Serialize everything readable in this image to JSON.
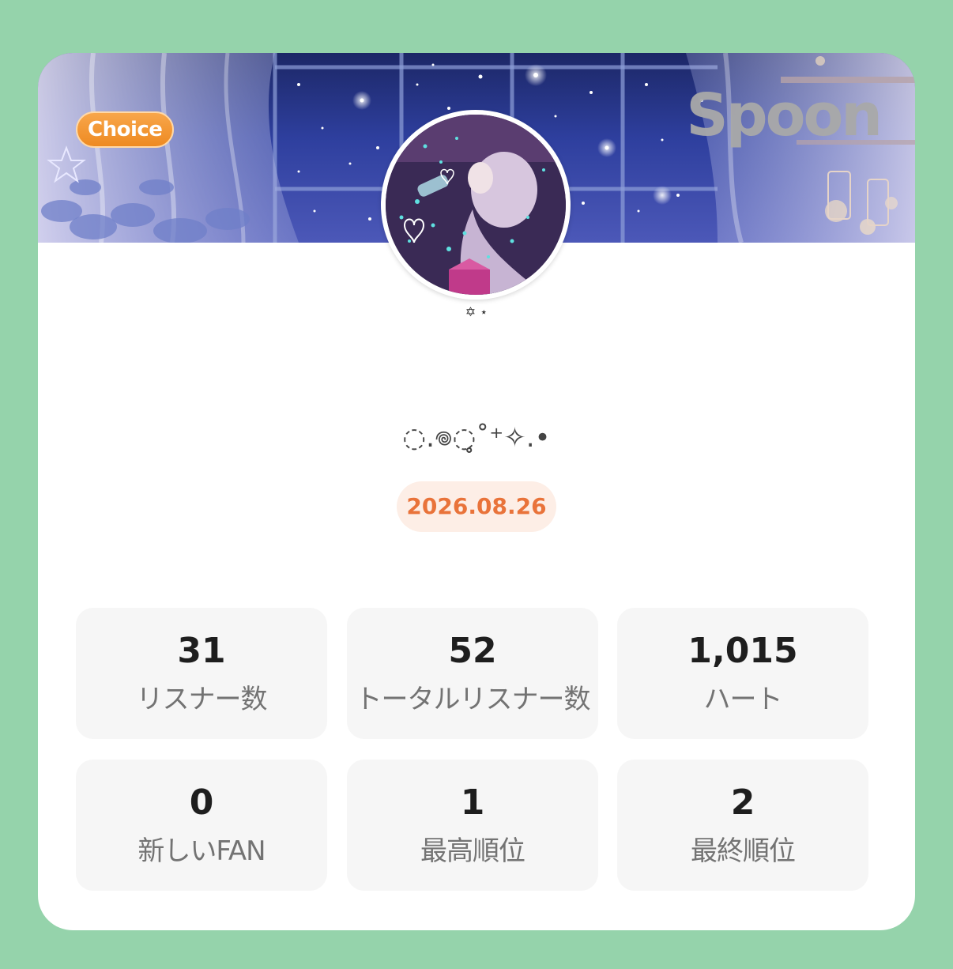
{
  "card": {
    "badge": "Choice",
    "brand": "Spoon",
    "avatar_icon": "profile-photo",
    "name_sub": "✡︎ ⋆",
    "name_main": "◌.𖦹◌̥˚⁺✧.•",
    "date": "2026.08.26"
  },
  "stats": [
    {
      "value": "31",
      "label": "リスナー数"
    },
    {
      "value": "52",
      "label": "トータルリスナー数"
    },
    {
      "value": "1,015",
      "label": "ハート"
    },
    {
      "value": "0",
      "label": "新しいFAN"
    },
    {
      "value": "1",
      "label": "最高順位"
    },
    {
      "value": "2",
      "label": "最終順位"
    }
  ],
  "colors": {
    "page_background": "#95d3ab",
    "badge": "#ee8a22",
    "date_text": "#e9733a",
    "date_background": "#fdeee6",
    "stat_tile": "#f6f6f6"
  }
}
